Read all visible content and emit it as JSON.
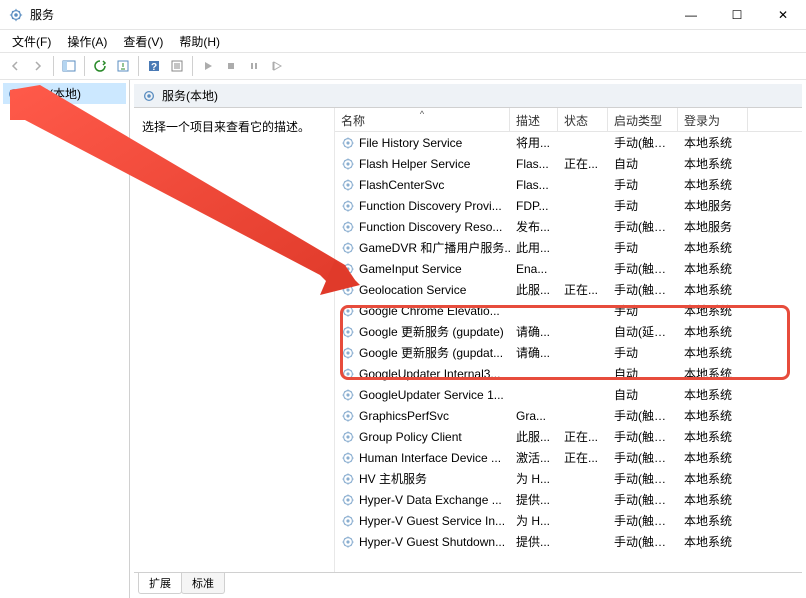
{
  "window": {
    "title": "服务",
    "controls": {
      "minimize": "—",
      "maximize": "☐",
      "close": "✕"
    }
  },
  "menu": [
    {
      "label": "文件(F)"
    },
    {
      "label": "操作(A)"
    },
    {
      "label": "查看(V)"
    },
    {
      "label": "帮助(H)"
    }
  ],
  "tree": {
    "root": "服务(本地)"
  },
  "right_header": "服务(本地)",
  "detail": {
    "prompt": "选择一个项目来查看它的描述。"
  },
  "columns": {
    "name": "名称",
    "desc": "描述",
    "status": "状态",
    "startup": "启动类型",
    "logon": "登录为"
  },
  "services": [
    {
      "name": "File History Service",
      "desc": "将用...",
      "status": "",
      "startup": "手动(触发...",
      "logon": "本地系统"
    },
    {
      "name": "Flash Helper Service",
      "desc": "Flas...",
      "status": "正在...",
      "startup": "自动",
      "logon": "本地系统"
    },
    {
      "name": "FlashCenterSvc",
      "desc": "Flas...",
      "status": "",
      "startup": "手动",
      "logon": "本地系统"
    },
    {
      "name": "Function Discovery Provi...",
      "desc": "FDP...",
      "status": "",
      "startup": "手动",
      "logon": "本地服务"
    },
    {
      "name": "Function Discovery Reso...",
      "desc": "发布...",
      "status": "",
      "startup": "手动(触发...",
      "logon": "本地服务"
    },
    {
      "name": "GameDVR 和广播用户服务...",
      "desc": "此用...",
      "status": "",
      "startup": "手动",
      "logon": "本地系统"
    },
    {
      "name": "GameInput Service",
      "desc": "Ena...",
      "status": "",
      "startup": "手动(触发...",
      "logon": "本地系统"
    },
    {
      "name": "Geolocation Service",
      "desc": "此服...",
      "status": "正在...",
      "startup": "手动(触发...",
      "logon": "本地系统"
    },
    {
      "name": "Google Chrome Elevatio...",
      "desc": "",
      "status": "",
      "startup": "手动",
      "logon": "本地系统"
    },
    {
      "name": "Google 更新服务 (gupdate)",
      "desc": "请确...",
      "status": "",
      "startup": "自动(延迟...",
      "logon": "本地系统"
    },
    {
      "name": "Google 更新服务 (gupdat...",
      "desc": "请确...",
      "status": "",
      "startup": "手动",
      "logon": "本地系统"
    },
    {
      "name": "GoogleUpdater Internal3...",
      "desc": "",
      "status": "",
      "startup": "自动",
      "logon": "本地系统"
    },
    {
      "name": "GoogleUpdater Service 1...",
      "desc": "",
      "status": "",
      "startup": "自动",
      "logon": "本地系统"
    },
    {
      "name": "GraphicsPerfSvc",
      "desc": "Gra...",
      "status": "",
      "startup": "手动(触发...",
      "logon": "本地系统"
    },
    {
      "name": "Group Policy Client",
      "desc": "此服...",
      "status": "正在...",
      "startup": "手动(触发...",
      "logon": "本地系统"
    },
    {
      "name": "Human Interface Device ...",
      "desc": "激活...",
      "status": "正在...",
      "startup": "手动(触发...",
      "logon": "本地系统"
    },
    {
      "name": "HV 主机服务",
      "desc": "为 H...",
      "status": "",
      "startup": "手动(触发...",
      "logon": "本地系统"
    },
    {
      "name": "Hyper-V Data Exchange ...",
      "desc": "提供...",
      "status": "",
      "startup": "手动(触发...",
      "logon": "本地系统"
    },
    {
      "name": "Hyper-V Guest Service In...",
      "desc": "为 H...",
      "status": "",
      "startup": "手动(触发...",
      "logon": "本地系统"
    },
    {
      "name": "Hyper-V Guest Shutdown...",
      "desc": "提供...",
      "status": "",
      "startup": "手动(触发...",
      "logon": "本地系统"
    }
  ],
  "tabs": {
    "extended": "扩展",
    "standard": "标准"
  }
}
